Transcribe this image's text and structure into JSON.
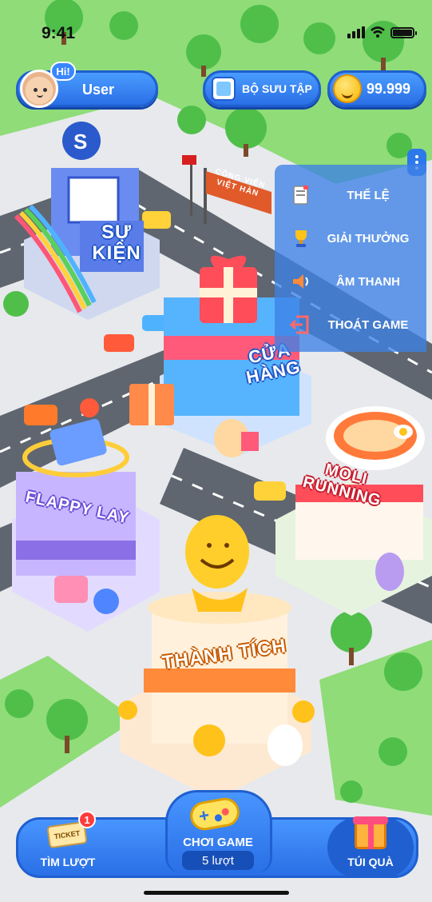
{
  "status_bar": {
    "time": "9:41"
  },
  "header": {
    "greeting": "Hi!",
    "user_name": "User",
    "collection_label": "BỘ SƯU TẬP",
    "coin_balance": "99.999"
  },
  "side_menu": {
    "items": [
      {
        "label": "THỂ LỆ",
        "icon": "rules-scroll-icon"
      },
      {
        "label": "GIẢI THƯỞNG",
        "icon": "trophy-icon"
      },
      {
        "label": "ÂM THANH",
        "icon": "speaker-icon"
      },
      {
        "label": "THOÁT GAME",
        "icon": "exit-icon"
      }
    ]
  },
  "map": {
    "buildings": {
      "event": "SỰ KIỆN",
      "shop": "CỬA HÀNG",
      "flappy": "FLAPPY LAY",
      "moli": "MOLI RUNNING",
      "achievement": "THÀNH TÍCH"
    },
    "park_sign": "CÔNG VIÊN VIỆT HÀN"
  },
  "bottom_bar": {
    "find_turns_label": "TÌM LƯỢT",
    "ticket_text": "TICKET",
    "ticket_badge": "1",
    "play_label": "CHƠI GAME",
    "turns_label": "5 lượt",
    "gift_bag_label": "TÚI QUÀ"
  },
  "colors": {
    "primary_blue": "#2a6fe6",
    "grass": "#7cd36b",
    "road": "#5f6670",
    "sidewalk": "#e7e9ec"
  }
}
